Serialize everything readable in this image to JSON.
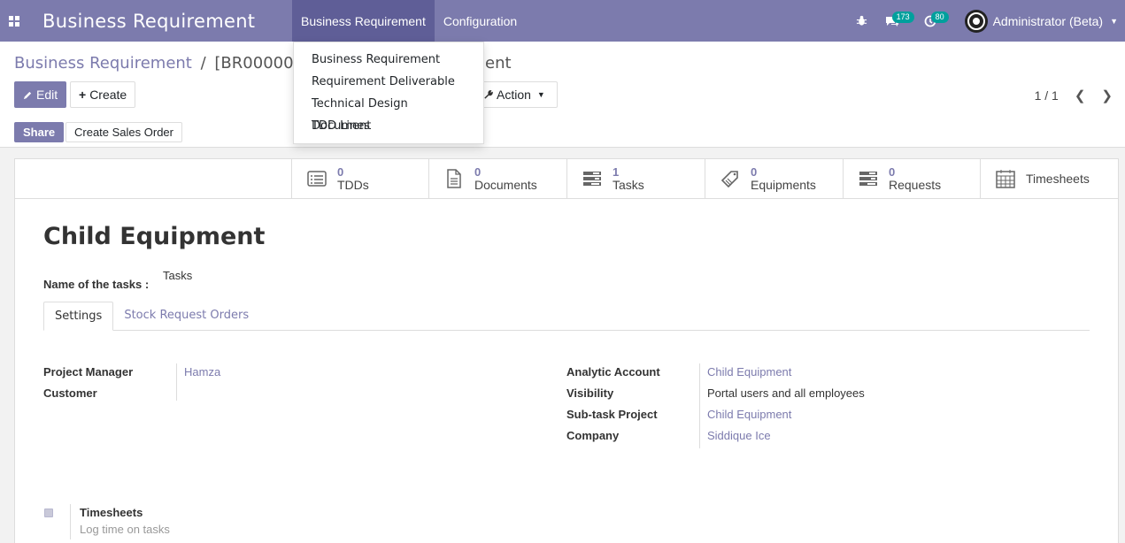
{
  "navbar": {
    "brand": "Business Requirement",
    "menus": [
      "Business Requirement",
      "Configuration"
    ],
    "messages_badge": "173",
    "activity_badge": "80",
    "user": "Administrator (Beta)"
  },
  "dropdown": {
    "items": [
      "Business Requirement",
      "Requirement Deliverable",
      "Technical Design Document",
      "TDD Lines"
    ]
  },
  "breadcrumb": {
    "parent": "Business Requirement",
    "separator": "/",
    "current_prefix": "[BR000002]",
    "current_suffix": "ent"
  },
  "toolbar": {
    "edit_label": "Edit",
    "create_label": "Create",
    "action_label": "Action",
    "pager": "1 / 1"
  },
  "statusbar": {
    "share_label": "Share",
    "create_sales_order_label": "Create Sales Order"
  },
  "smart_buttons": [
    {
      "count": "0",
      "label": "TDDs",
      "icon": "list-icon"
    },
    {
      "count": "0",
      "label": "Documents",
      "icon": "document-icon"
    },
    {
      "count": "1",
      "label": "Tasks",
      "icon": "tasks-icon"
    },
    {
      "count": "0",
      "label": "Equipments",
      "icon": "tag-icon"
    },
    {
      "count": "0",
      "label": "Requests",
      "icon": "tasks-icon"
    },
    {
      "count": "",
      "label": "Timesheets",
      "icon": "calendar-icon"
    }
  ],
  "record": {
    "title": "Child Equipment",
    "tasks_label": "Name of the tasks :",
    "tasks_value": "Tasks"
  },
  "tabs": [
    "Settings",
    "Stock Request Orders"
  ],
  "left_fields": [
    {
      "label": "Project Manager",
      "value": "Hamza"
    },
    {
      "label": "Customer",
      "value": ""
    }
  ],
  "right_fields": [
    {
      "label": "Analytic Account",
      "value": "Child Equipment"
    },
    {
      "label": "Visibility",
      "value": "Portal users and all employees"
    },
    {
      "label": "Sub-task Project",
      "value": "Child Equipment"
    },
    {
      "label": "Company",
      "value": "Siddique Ice"
    }
  ],
  "timesheets": {
    "title": "Timesheets",
    "subtitle": "Log time on tasks"
  },
  "colors": {
    "brand": "#7c7bad",
    "brand_dark": "#5f5e97",
    "badge": "#00a09d"
  }
}
